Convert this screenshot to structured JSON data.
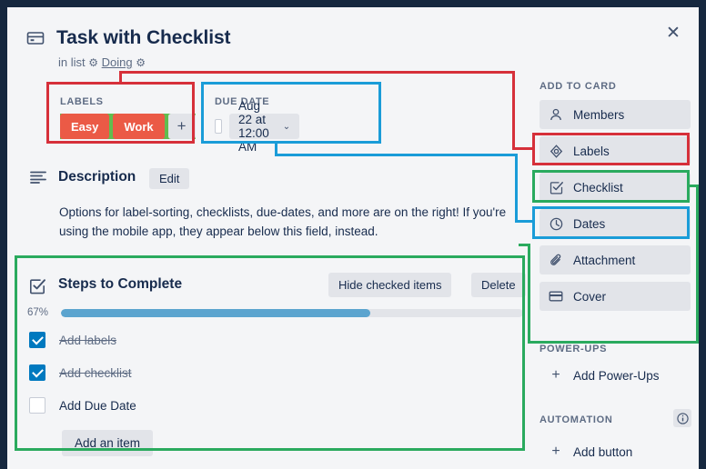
{
  "card": {
    "title": "Task with Checklist",
    "in_list_prefix": "in list",
    "list_name": "Doing",
    "gear_glyph": "⚙",
    "close_glyph": "✕"
  },
  "labels_section": {
    "heading": "LABELS",
    "chips": [
      {
        "text": "Easy",
        "color": "#61bd4f"
      },
      {
        "text": "Work",
        "color": "#eb5a46"
      }
    ],
    "add_glyph": "+"
  },
  "due_section": {
    "heading": "DUE DATE",
    "value": "Aug 22 at 12:00 AM",
    "caret_glyph": "⌄"
  },
  "description": {
    "heading": "Description",
    "edit_label": "Edit",
    "body": "Options for label-sorting, checklists, due-dates, and more are on the right! If you're using the mobile app, they appear below this field, instead."
  },
  "checklist": {
    "title": "Steps to Complete",
    "hide_label": "Hide checked items",
    "delete_label": "Delete",
    "percent_label": "67%",
    "percent_value": 67,
    "add_item_label": "Add an item",
    "items": [
      {
        "label": "Add labels",
        "checked": true
      },
      {
        "label": "Add checklist",
        "checked": true
      },
      {
        "label": "Add Due Date",
        "checked": false
      }
    ]
  },
  "sidebar": {
    "add_to_card_heading": "ADD TO CARD",
    "add_to_card": [
      {
        "label": "Members",
        "icon": "person-icon"
      },
      {
        "label": "Labels",
        "icon": "label-tag-icon"
      },
      {
        "label": "Checklist",
        "icon": "checklist-icon"
      },
      {
        "label": "Dates",
        "icon": "clock-icon"
      },
      {
        "label": "Attachment",
        "icon": "paperclip-icon"
      },
      {
        "label": "Cover",
        "icon": "cover-icon"
      }
    ],
    "powerups_heading": "POWER-UPS",
    "add_powerups_label": "Add Power-Ups",
    "automation_heading": "AUTOMATION",
    "add_button_label": "Add button",
    "plus_glyph": "+",
    "info_glyph": "ⓘ"
  },
  "annotations": {
    "red": "#d6303a",
    "green": "#2aaa5e",
    "blue": "#1a9cd8"
  }
}
